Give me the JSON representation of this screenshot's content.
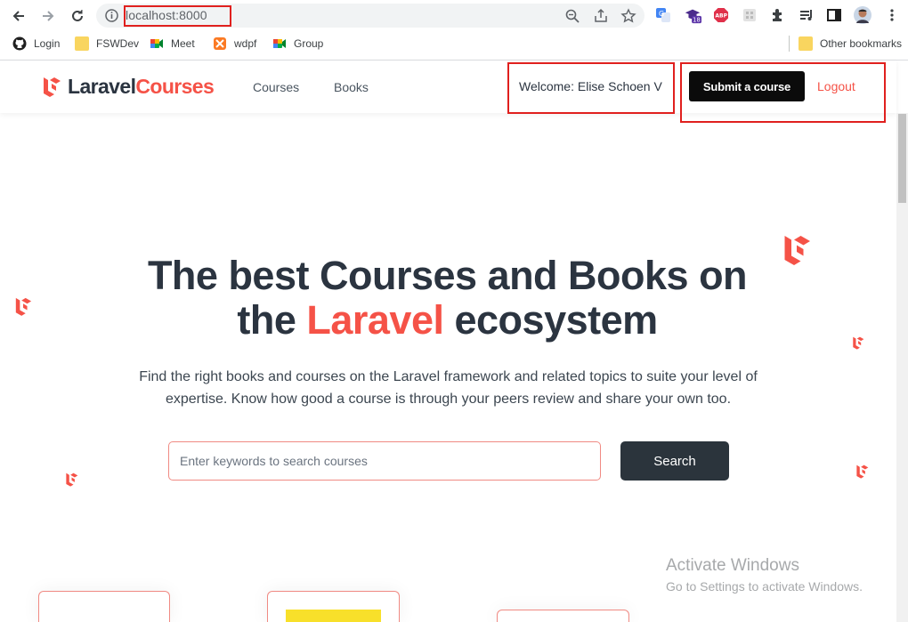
{
  "browser": {
    "url": "localhost:8000",
    "bookmarks": [
      {
        "label": "Login",
        "icon": "github-icon"
      },
      {
        "label": "FSWDev",
        "icon": "folder-icon"
      },
      {
        "label": "Meet",
        "icon": "meet-icon"
      },
      {
        "label": "wdpf",
        "icon": "xampp-icon"
      },
      {
        "label": "Group",
        "icon": "meet-icon"
      }
    ],
    "other_bookmarks": "Other bookmarks",
    "extension_badge": "18"
  },
  "header": {
    "logo_part1": "Laravel",
    "logo_part2": "Courses",
    "nav": [
      "Courses",
      "Books"
    ],
    "welcome": "Welcome: Elise Schoen V",
    "submit_label": "Submit a course",
    "logout_label": "Logout"
  },
  "hero": {
    "title_line1": "The best Courses and Books on",
    "title_the": "the",
    "title_accent": "Laravel",
    "title_end": "ecosystem",
    "subtitle": "Find the right books and courses on the Laravel framework and related topics to suite your level of expertise. Know how good a course is through your peers review and share your own too.",
    "search_placeholder": "Enter keywords to search courses",
    "search_button": "Search"
  },
  "watermark": {
    "line1": "Activate Windows",
    "line2": "Go to Settings to activate Windows."
  },
  "colors": {
    "accent": "#f55247",
    "dark": "#2b3440",
    "highlight": "#e0201e"
  }
}
